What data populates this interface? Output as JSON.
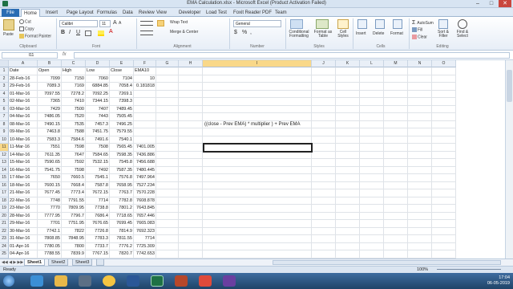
{
  "window": {
    "title": "EMA Calculation.xlsx - Microsoft Excel (Product Activation Failed)",
    "min": "–",
    "max": "□",
    "close": "✕"
  },
  "ribbon_tabs": [
    "Home",
    "Insert",
    "Page Layout",
    "Formulas",
    "Data",
    "Review",
    "View",
    "Developer",
    "Load Test",
    "Foxit Reader PDF",
    "Team"
  ],
  "file_tab": "File",
  "clipboard": {
    "paste": "Paste",
    "cut": "Cut",
    "copy": "Copy",
    "format_painter": "Format Painter",
    "label": "Clipboard"
  },
  "font": {
    "name": "Calibri",
    "size": "11",
    "bold": "B",
    "italic": "I",
    "underline": "U",
    "grow": "A",
    "shrink": "A",
    "label": "Font"
  },
  "alignment": {
    "wrap": "Wrap Text",
    "merge": "Merge & Center",
    "label": "Alignment"
  },
  "number": {
    "format": "General",
    "currency": "$",
    "percent": "%",
    "comma": ",",
    "label": "Number"
  },
  "styles": {
    "conditional": "Conditional Formatting",
    "table": "Format as Table",
    "cell": "Cell Styles",
    "label": "Styles"
  },
  "cells": {
    "insert": "Insert",
    "delete": "Delete",
    "format": "Format",
    "label": "Cells"
  },
  "editing": {
    "autosum": "AutoSum",
    "fill": "Fill",
    "clear": "Clear",
    "sort": "Sort & Filter",
    "find": "Find & Select",
    "label": "Editing"
  },
  "formula_bar": {
    "name_box": "I11",
    "fx": "fx",
    "value": ""
  },
  "columns": [
    "A",
    "B",
    "C",
    "D",
    "E",
    "F",
    "G",
    "H",
    "I",
    "J",
    "K",
    "L",
    "M",
    "N",
    "O"
  ],
  "headers": [
    "Date",
    "Open",
    "High",
    "Low",
    "Close",
    "EMA10"
  ],
  "rows": [
    [
      "28-Feb-16",
      "7099",
      "7150",
      "7060",
      "7104",
      "10"
    ],
    [
      "29-Feb-16",
      "7089.3",
      "7169",
      "6884.85",
      "7058.4",
      "0.181818"
    ],
    [
      "01-Mar-16",
      "7097.55",
      "7278.2",
      "7092.25",
      "7269.1",
      ""
    ],
    [
      "02-Mar-16",
      "7365",
      "7410",
      "7344.15",
      "7398.3",
      ""
    ],
    [
      "03-Mar-16",
      "7429",
      "7500",
      "7407",
      "7489.45",
      ""
    ],
    [
      "04-Mar-16",
      "7486.05",
      "7520",
      "7443",
      "7505.45",
      ""
    ],
    [
      "08-Mar-16",
      "7490.15",
      "7535",
      "7457.3",
      "7496.25",
      ""
    ],
    [
      "09-Mar-16",
      "7463.8",
      "7588",
      "7451.75",
      "7579.55",
      ""
    ],
    [
      "10-Mar-16",
      "7583.3",
      "7584.6",
      "7491.6",
      "7540.1",
      ""
    ],
    [
      "11-Mar-16",
      "7551",
      "7598",
      "7508",
      "7565.45",
      "7401.005"
    ],
    [
      "14-Mar-16",
      "7611.35",
      "7647",
      "7584.65",
      "7598.35",
      "7436.886"
    ],
    [
      "15-Mar-16",
      "7590.65",
      "7592",
      "7532.15",
      "7545.8",
      "7456.688"
    ],
    [
      "16-Mar-16",
      "7541.75",
      "7598",
      "7492",
      "7587.35",
      "7480.445"
    ],
    [
      "17-Mar-16",
      "7650",
      "7660.5",
      "7545.1",
      "7576.8",
      "7497.964"
    ],
    [
      "18-Mar-16",
      "7600.15",
      "7668.4",
      "7587.8",
      "7658.95",
      "7527.234"
    ],
    [
      "21-Mar-16",
      "7677.45",
      "7773.4",
      "7672.15",
      "7763.7",
      "7570.228"
    ],
    [
      "22-Mar-16",
      "7748",
      "7791.55",
      "7714",
      "7782.8",
      "7608.878"
    ],
    [
      "23-Mar-16",
      "7770",
      "7809.95",
      "7738.8",
      "7801.2",
      "7643.845"
    ],
    [
      "28-Mar-16",
      "7777.95",
      "7796.7",
      "7686.4",
      "7718.65",
      "7657.446"
    ],
    [
      "29-Mar-16",
      "7701",
      "7751.95",
      "7676.65",
      "7699.45",
      "7665.083"
    ],
    [
      "30-Mar-16",
      "7742.1",
      "7822",
      "7726.8",
      "7814.9",
      "7692.323"
    ],
    [
      "31-Mar-16",
      "7808.85",
      "7848.95",
      "7783.3",
      "7811.55",
      "7714"
    ],
    [
      "01-Apr-16",
      "7780.05",
      "7800",
      "7733.7",
      "7776.2",
      "7725.309"
    ],
    [
      "04-Apr-16",
      "7788.55",
      "7839.9",
      "7767.15",
      "7820.7",
      "7742.653"
    ]
  ],
  "note": "((close - Prev EMA) * multiplier ) + Prev EMA",
  "sheets": [
    "Sheet1",
    "Sheet2",
    "Sheet3"
  ],
  "status": {
    "ready": "Ready",
    "zoom": "100%"
  },
  "clock": {
    "time": "17:04",
    "date": "06-05-2019"
  },
  "colors": {
    "accent": "#2a6db3",
    "selected_header": "#f9d889",
    "taskbar": "#1f4468"
  }
}
